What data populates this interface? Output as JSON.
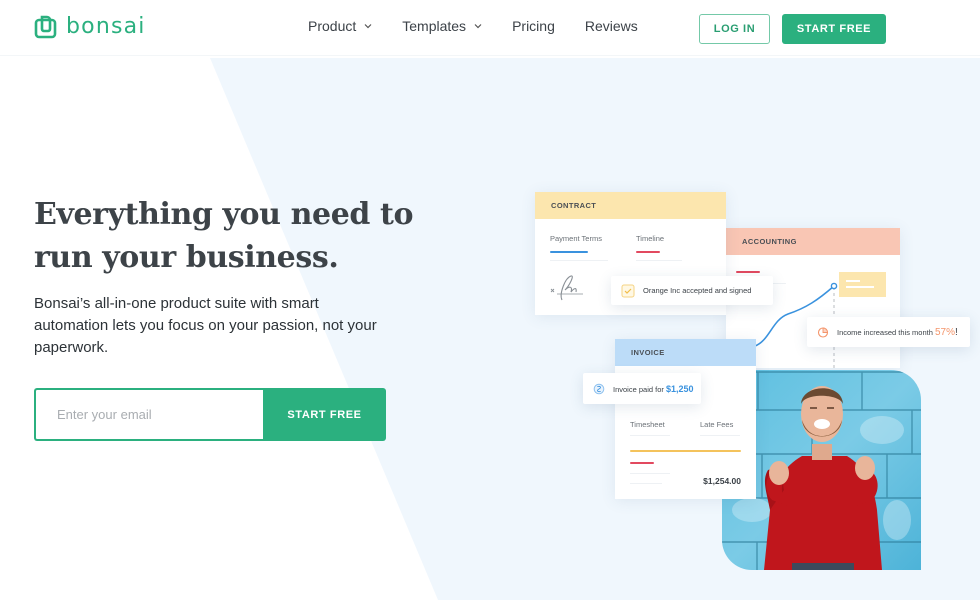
{
  "header": {
    "logo_text": "bonsai",
    "nav": [
      {
        "label": "Product",
        "has_dropdown": true
      },
      {
        "label": "Templates",
        "has_dropdown": true
      },
      {
        "label": "Pricing",
        "has_dropdown": false
      },
      {
        "label": "Reviews",
        "has_dropdown": false
      }
    ],
    "login_label": "LOG IN",
    "start_free_label": "START FREE"
  },
  "hero": {
    "title_line1": "Everything you need to",
    "title_line2": "run your business.",
    "subtitle": "Bonsai’s all-in-one product suite with smart automation lets you focus on your passion, not your paperwork.",
    "email_placeholder": "Enter your email",
    "email_value": "",
    "cta_label": "START FREE"
  },
  "illustration": {
    "contract": {
      "title": "CONTRACT",
      "col1": "Payment Terms",
      "col2": "Timeline",
      "signature_icon": "signature-icon"
    },
    "accounting": {
      "title": "ACCOUNTING"
    },
    "invoice": {
      "title": "INVOICE",
      "col1": "Timesheet",
      "col2": "Late Fees",
      "total": "$1,254.00"
    },
    "toasts": {
      "contract_signed": "Orange Inc accepted and signed",
      "income_text": "Income increased this month",
      "income_value": "57%",
      "income_suffix": "!",
      "invoice_text": "Invoice paid for",
      "invoice_value": "$1,250"
    }
  },
  "colors": {
    "brand_green": "#2bb07f",
    "hero_bg": "#f0f7fd",
    "contract_yellow": "#fce6ae",
    "accounting_salmon": "#f9c6b4",
    "invoice_blue": "#bcdcf8"
  }
}
